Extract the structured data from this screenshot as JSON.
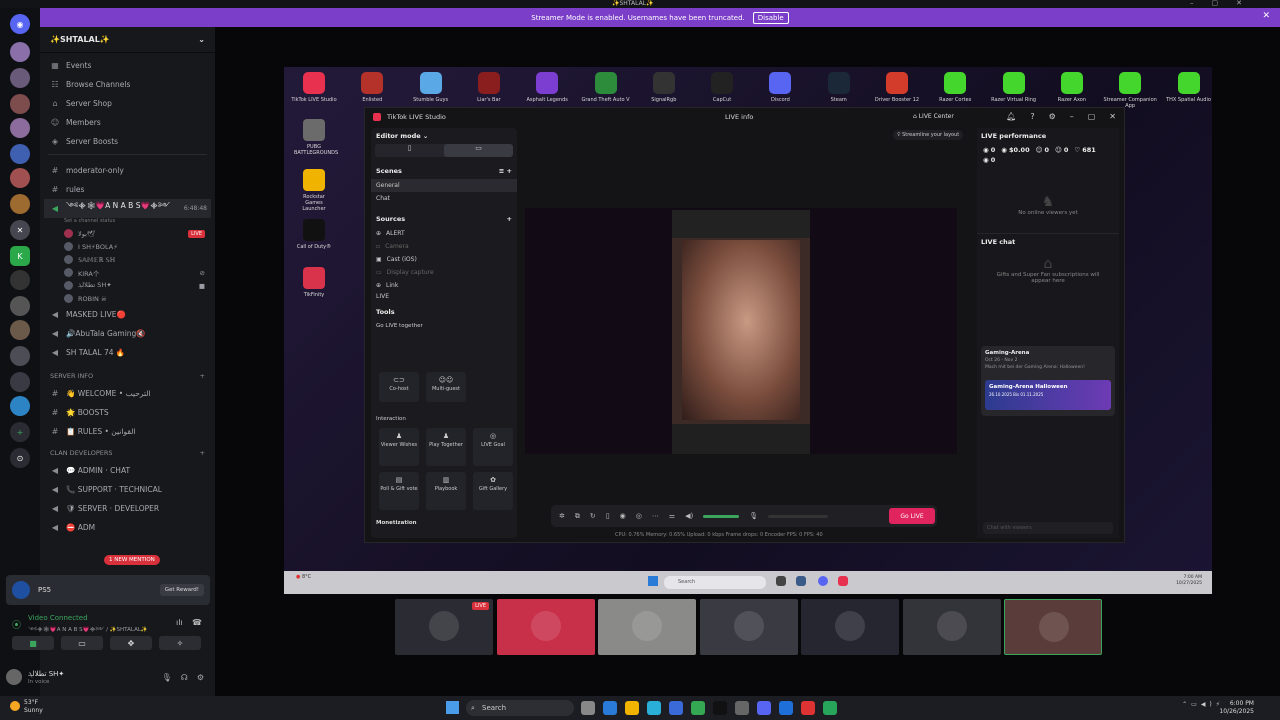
{
  "window": {
    "title": "✨SHTALAL✨"
  },
  "banner": {
    "text": "Streamer Mode is enabled. Usernames have been truncated.",
    "button": "Disable"
  },
  "guild": {
    "name": "✨SHTALAL✨"
  },
  "nav": [
    {
      "icon": "calendar-icon",
      "label": "Events"
    },
    {
      "icon": "compass-icon",
      "label": "Browse Channels"
    },
    {
      "icon": "shop-icon",
      "label": "Server Shop"
    },
    {
      "icon": "members-icon",
      "label": "Members"
    },
    {
      "icon": "boost-icon",
      "label": "Server Boosts"
    }
  ],
  "channels_top": [
    {
      "icon": "#",
      "label": "moderator-only"
    },
    {
      "icon": "#",
      "label": "rules"
    }
  ],
  "voice_main": {
    "label": "༺᯽🕸💗A N A B S💗᯽༻",
    "time": "6:48:48",
    "status": "Set a channel status"
  },
  "voice_users": [
    {
      "name": "بولا🕊",
      "live": "LIVE"
    },
    {
      "name": "I SH⚡BOLA⚡"
    },
    {
      "name": "𝕊𝔸𝕄𝔼ℝ 𝕊ℍ"
    },
    {
      "name": "KIRA个"
    },
    {
      "name": "ﺗﻄﻼلܓ SH✦"
    },
    {
      "name": "ROBIN ☠"
    }
  ],
  "channels_mid": [
    {
      "icon": "speaker",
      "label": "MASKED LIVE🔴"
    },
    {
      "icon": "speaker",
      "label": "🔊AbuTala Gaming🔇"
    },
    {
      "icon": "speaker",
      "label": "SH TALAL 74 🔥"
    }
  ],
  "cat1": "SERVER INFO",
  "channels_info": [
    {
      "label": "👋 WELCOME • الترحيب"
    },
    {
      "label": "🌟 BOOSTS"
    },
    {
      "label": "📋 RULES • القوانين"
    }
  ],
  "cat2": "CLAN DEVELOPERS",
  "channels_dev": [
    {
      "label": "💬 ADMIN · CHAT"
    },
    {
      "label": "📞 SUPPORT · TECHNICAL"
    },
    {
      "label": "🛡 SERVER · DEVELOPER"
    },
    {
      "label": "⛔ ADM"
    }
  ],
  "mention": "1 NEW MENTION",
  "ps_card": {
    "label": "PS5",
    "button": "Get Reward!"
  },
  "voice_panel": {
    "status": "Video Connected",
    "channel": "༺᯽🕸💗A N A B S💗᯽༻ / ✨SHTALAL✨"
  },
  "user": {
    "name": "ﺗﻄﻼلܓ SH✦",
    "status": "In voice"
  },
  "apps": [
    {
      "label": "TikTok LIVE Studio",
      "color": "#e8304f"
    },
    {
      "label": "Enlisted",
      "color": "#b5322a"
    },
    {
      "label": "Stumble Guys",
      "color": "#5aa9e6"
    },
    {
      "label": "Liar's Bar",
      "color": "#8a1d1d"
    },
    {
      "label": "Asphalt Legends",
      "color": "#7c3ed0"
    },
    {
      "label": "Grand Theft Auto V",
      "color": "#2c8c3c"
    },
    {
      "label": "SignalRgb",
      "color": "#333333"
    },
    {
      "label": "CapCut",
      "color": "#222222"
    },
    {
      "label": "Discord",
      "color": "#5865f2"
    },
    {
      "label": "Steam",
      "color": "#1b2838"
    },
    {
      "label": "Driver Booster 12",
      "color": "#d33c2b"
    },
    {
      "label": "Razer Cortex",
      "color": "#44d62c"
    },
    {
      "label": "Razer Virtual Ring",
      "color": "#44d62c"
    },
    {
      "label": "Razer Axon",
      "color": "#44d62c"
    },
    {
      "label": "Streamer Companion App",
      "color": "#44d62c"
    },
    {
      "label": "THX Spatial Audio",
      "color": "#44d62c"
    }
  ],
  "desk_icons": [
    {
      "label": "PUBG BATTLEGROUNDS",
      "color": "#6b6b6b"
    },
    {
      "label": "Rockstar Games Launcher",
      "color": "#f0b400"
    },
    {
      "label": "Call of Duty®",
      "color": "#111111"
    },
    {
      "label": "TikFinity",
      "color": "#d9334c"
    }
  ],
  "studio": {
    "title": "TikTok LIVE Studio",
    "live_info": "LIVE info",
    "live_center": "LIVE Center",
    "editor_mode": "Editor mode",
    "scenes": "Scenes",
    "scene_items": [
      "General",
      "Chat"
    ],
    "sources": "Sources",
    "source_items": [
      "ALERT",
      "Camera",
      "Cast (iOS)",
      "Display capture",
      "Link",
      "LIVE"
    ],
    "tools": "Tools",
    "go_live_together": "Go LIVE together",
    "tool_together": [
      "Co-host",
      "Multi-guest"
    ],
    "interaction": "Interaction",
    "tool_interaction": [
      "Viewer Wishes",
      "Play Together",
      "LIVE Goal",
      "Poll & Gift vote",
      "Playbook",
      "Gift Gallery"
    ],
    "monetization": "Monetization",
    "streamline": "Streamline your layout",
    "go_live": "Go LIVE",
    "stats": "CPU: 0.76%   Memory: 0.65%   Upload: 0 kbps   Frame drops: 0   Encoder FPS: 0   FPS: 40",
    "perf_title": "LIVE performance",
    "perf": [
      "0",
      "$0.00",
      "0",
      "0",
      "681",
      "0"
    ],
    "no_viewers": "No online viewers yet",
    "chat_title": "LIVE chat",
    "chat_empty": "Gifts and Super Fan subscriptions will appear here",
    "event_title": "Gaming-Arena",
    "event_date": "Oct 26 - Nov 2",
    "event_desc": "Mach mit bei der Gaming Arena: Halloween!",
    "event_banner": "Gaming-Arena Halloween",
    "event_banner_sub": "26.10.2025 Bis 01.11.2025",
    "chat_placeholder": "Chat with viewers"
  },
  "win_taskbar": {
    "weather": "8°C",
    "search": "Search",
    "time": "7:00 AM",
    "date": "10/27/2025"
  },
  "tiles": [
    {
      "color": "#2b2c33",
      "live": "LIVE"
    },
    {
      "color": "#c8304a"
    },
    {
      "color": "#8a8a88"
    },
    {
      "color": "#3a3b42"
    },
    {
      "color": "#262631"
    },
    {
      "color": "#33333a"
    },
    {
      "color": "#5a3c3a"
    }
  ],
  "os": {
    "weather_temp": "53°F",
    "weather_desc": "Sunny",
    "search": "Search",
    "time": "6:00 PM",
    "date": "10/26/2025"
  }
}
